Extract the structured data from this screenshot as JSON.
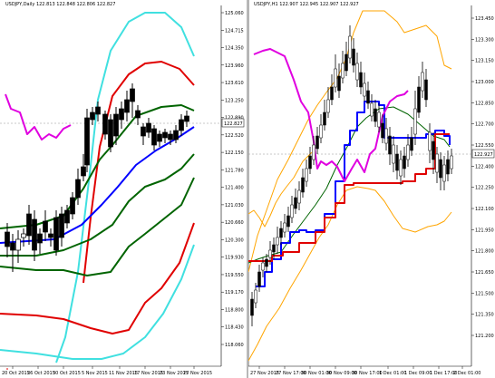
{
  "left": {
    "title": "USDJPY,Daily  122.813 122.848 122.806 122.827",
    "y_ticks": [
      "125.060",
      "124.715",
      "124.350",
      "123.960",
      "123.610",
      "123.250",
      "122.890",
      "122.520",
      "122.150",
      "121.780",
      "121.400",
      "121.030",
      "120.660",
      "120.300",
      "119.930",
      "119.550",
      "119.170",
      "118.800",
      "118.430",
      "118.060"
    ],
    "x_ticks": [
      "20 Oct 2015",
      "26 Oct 2015",
      "30 Oct 2015",
      "5 Nov 2015",
      "11 Nov 2015",
      "17 Nov 2015",
      "23 Nov 2015",
      "27 Nov 2015"
    ],
    "current_price": "122.827",
    "colors": {
      "bb3": "#40e0e0",
      "bb2": "#e00000",
      "bb1": "#006400",
      "ma": "#0000ff",
      "chikou": "#e000e0",
      "candle": "#000000"
    }
  },
  "right": {
    "title": "USDJPY,H1  122.907 122.945 122.907 122.927",
    "y_ticks": [
      "123.450",
      "123.300",
      "123.150",
      "123.000",
      "122.850",
      "122.700",
      "122.550",
      "122.400",
      "122.250",
      "122.100",
      "121.950",
      "121.800",
      "121.650",
      "121.500",
      "121.350",
      "121.200"
    ],
    "x_ticks": [
      "27 Nov 2015",
      "27 Nov 17:00",
      "30 Nov 01:00",
      "30 Nov 09:00",
      "30 Nov 17:00",
      "1 Dec 01:00",
      "1 Dec 09:00",
      "1 Dec 17:00",
      "2 Dec 01:00"
    ],
    "current_price": "122.927",
    "colors": {
      "env": "#ffa500",
      "base": "#e00000",
      "mid": "#006400",
      "conv": "#0000ff",
      "chikou": "#e000e0",
      "candle": "#000000"
    }
  }
}
